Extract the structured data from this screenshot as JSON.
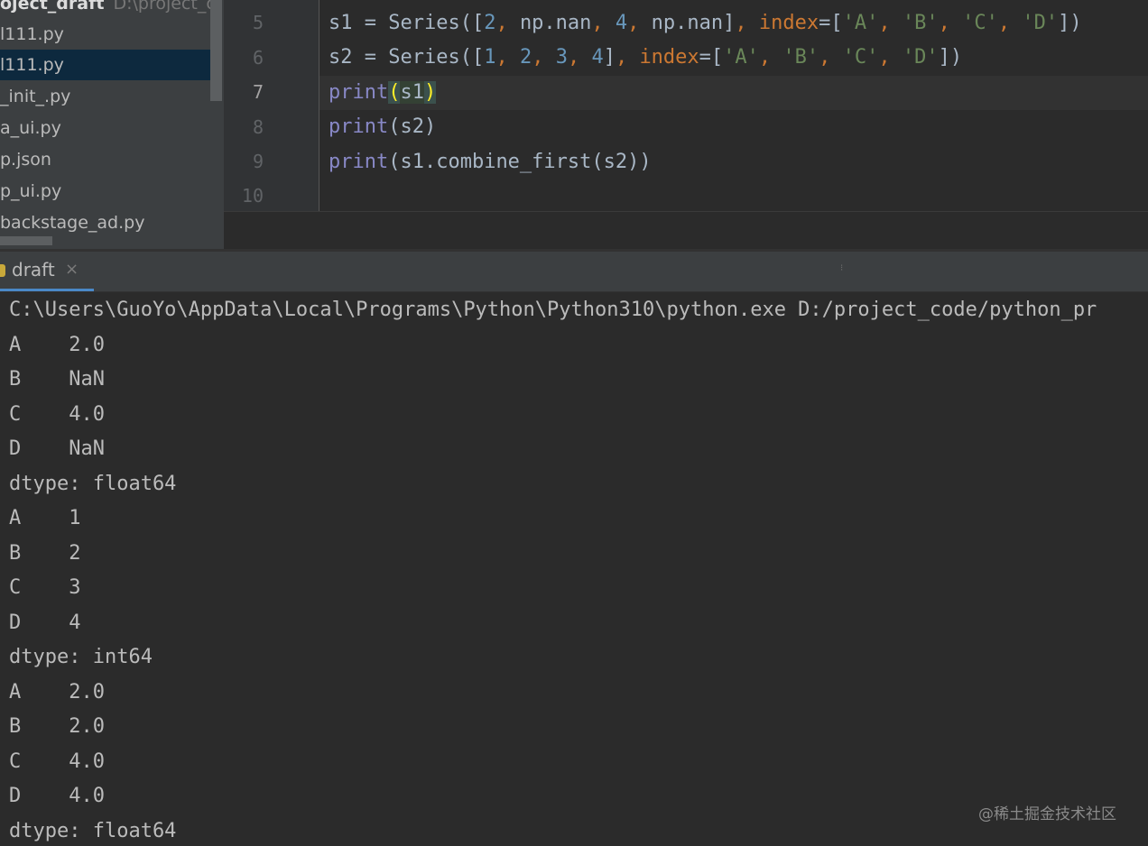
{
  "project_tree": {
    "header_name": "oject_draft",
    "header_path": "D:\\project_cod",
    "items": [
      {
        "label": "l111.py",
        "selected": false
      },
      {
        "label": "l111.py",
        "selected": true
      },
      {
        "label": "_init_.py",
        "selected": false
      },
      {
        "label": "a_ui.py",
        "selected": false
      },
      {
        "label": "p.json",
        "selected": false
      },
      {
        "label": "p_ui.py",
        "selected": false
      },
      {
        "label": "backstage_ad.py",
        "selected": false
      }
    ]
  },
  "editor": {
    "line_numbers": [
      "5",
      "6",
      "7",
      "8",
      "9",
      "10"
    ],
    "current_line": "7",
    "code_lines": [
      "s1 = Series([2, np.nan, 4, np.nan], index=['A', 'B', 'C', 'D'])",
      "s2 = Series([1, 2, 3, 4], index=['A', 'B', 'C', 'D'])",
      "print(s1)",
      "print(s2)",
      "print(s1.combine_first(s2))",
      ""
    ]
  },
  "run_panel": {
    "tab_label": "draft",
    "tab_close": "×",
    "grip": "⁝"
  },
  "console": {
    "lines": [
      "C:\\Users\\GuoYo\\AppData\\Local\\Programs\\Python\\Python310\\python.exe D:/project_code/python_pr",
      "A    2.0",
      "B    NaN",
      "C    4.0",
      "D    NaN",
      "dtype: float64",
      "A    1",
      "B    2",
      "C    3",
      "D    4",
      "dtype: int64",
      "A    2.0",
      "B    2.0",
      "C    4.0",
      "D    4.0",
      "dtype: float64"
    ]
  },
  "watermark": "@稀土掘金技术社区",
  "colors": {
    "background": "#2b2b2b",
    "keyword": "#cc7832",
    "number": "#6897bb",
    "string": "#6a8759",
    "builtin": "#8888c6",
    "selection": "#0d293e",
    "tab_underline": "#4a88c7"
  }
}
